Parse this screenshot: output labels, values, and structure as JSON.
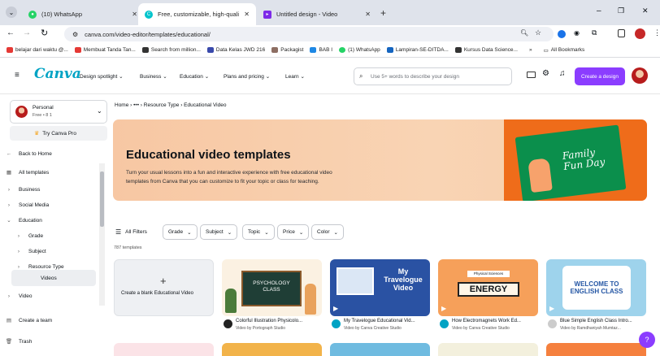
{
  "browser": {
    "tabs": [
      {
        "title": "(10) WhatsApp",
        "icon": "whatsapp-icon",
        "color": "#25d366"
      },
      {
        "title": "Free, customizable, high-qualit",
        "icon": "canva-icon",
        "color": "#00c4cc"
      },
      {
        "title": "Untitled design - Video",
        "icon": "canva-video-icon",
        "color": "#7d2ae8"
      }
    ],
    "new_tab": "+",
    "url": "canva.com/video-editor/templates/educational/",
    "bookmarks": [
      "belajar dari waktu @...",
      "Membuat Tanda Tan...",
      "Search from million...",
      "Data Kelas JWD 216",
      "Packagist",
      "BAB I",
      "(1) WhatsApp",
      "Lampiran-SE-DITDA...",
      "Kursus Data Science..."
    ],
    "more_bookmarks": "»",
    "all_bookmarks": "All Bookmarks"
  },
  "header": {
    "logo": "Canva",
    "nav": [
      "Design spotlight",
      "Business",
      "Education",
      "Plans and pricing",
      "Learn"
    ],
    "search_placeholder": "Use 5+ words to describe your design",
    "create_button": "Create a design"
  },
  "sidebar": {
    "account_name": "Personal",
    "account_sub": "Free • 8 1",
    "try_pro": "Try Canva Pro",
    "items": [
      {
        "label": "Back to Home",
        "icon": "arrow-left-icon"
      },
      {
        "label": "All templates",
        "icon": "templates-icon"
      },
      {
        "label": "Business",
        "icon": "chevron-right-icon"
      },
      {
        "label": "Social Media",
        "icon": "chevron-right-icon"
      },
      {
        "label": "Education",
        "icon": "chevron-down-icon"
      },
      {
        "label": "Grade",
        "icon": "chevron-right-icon"
      },
      {
        "label": "Subject",
        "icon": "chevron-right-icon"
      },
      {
        "label": "Resource Type",
        "icon": "chevron-right-icon"
      },
      {
        "label": "Videos",
        "icon": ""
      },
      {
        "label": "Video",
        "icon": "chevron-right-icon"
      }
    ],
    "create_team": "Create a team",
    "trash": "Trash"
  },
  "breadcrumb": [
    "Home",
    "•••",
    "Resource Type",
    "Educational Video"
  ],
  "hero": {
    "title": "Educational video templates",
    "description_line1": "Turn your usual lessons into a fun and interactive experience with free educational video",
    "description_line2": "templates from Canva that you can customize to fit your topic or class for teaching.",
    "image_text_line1": "Family",
    "image_text_line2": "Fun Day"
  },
  "filters": [
    "All Filters",
    "Grade",
    "Subject",
    "Topic",
    "Price",
    "Color"
  ],
  "template_count": "787 templates",
  "blank_card": {
    "plus": "+",
    "label": "Create a blank Educational Video"
  },
  "templates": [
    {
      "title": "Colorful Illustration Physicolo...",
      "by": "Video by Portograph Studio",
      "thumb_line1": "PSYCHOLOGY",
      "thumb_line2": "CLASS"
    },
    {
      "title": "My Travelogue Educational Vid...",
      "by": "Video by Canva Creative Studio",
      "thumb_line1": "My",
      "thumb_line2": "Travelogue",
      "thumb_line3": "Video"
    },
    {
      "title": "How Electromagnets Work Ed...",
      "by": "Video by Canva Creative Studio",
      "thumb_line1": "Physical Sciences",
      "thumb_line2": "ENERGY"
    },
    {
      "title": "Blue Simple English Class Intro...",
      "by": "Video by Ramdhaniyah Mumtaz...",
      "thumb_line1": "WELCOME TO",
      "thumb_line2": "ENGLISH CLASS"
    }
  ],
  "help": "?",
  "colors": {
    "accent": "#8b3dff",
    "hero": "#f7c7a3",
    "green": "#0f9d58"
  }
}
